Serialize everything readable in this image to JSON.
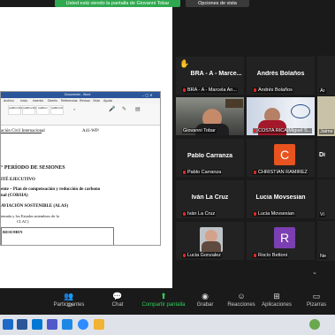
{
  "banner": {
    "sharing_text": "Usted está viendo la pantalla de Giovanni Tobar",
    "view_options": "Opciones de vista"
  },
  "shared_doc": {
    "word_title": "Documento - Word",
    "tabs": [
      "Archivo",
      "Inicio",
      "Insertar",
      "Diseño",
      "Referencias",
      "Revisar",
      "Vista",
      "Ayuda"
    ],
    "styles": [
      "AaBbCcDd",
      "AaBbCcDd",
      "AaBbCc",
      "AaBbCcD"
    ],
    "lines": {
      "org": "ación Civil Internacional",
      "code": "A41-WP/",
      "session": "° PERÍODO DE SESIONES",
      "committee": "ITÉ EJECUTIVO",
      "topic1": "ente – Plan de compensación y reducción de carbono",
      "topic2": "nal (CORSIA)",
      "alas": "AVIACIÓN SOSTENIBLE (ALAS)",
      "states1": "temala y los Estados miembros de la",
      "states2": "CLAC)",
      "resumen": "RESUMEN"
    }
  },
  "participants": [
    {
      "name": "BRA - A - Marce...",
      "caption": "BRA - A - Marcela An...",
      "type": "name",
      "hand": true
    },
    {
      "name": "Andrés Bolaños",
      "caption": "Andrés Bolaños",
      "type": "name"
    },
    {
      "name": "Giovanni Tobar",
      "caption": "Giovanni Tobar",
      "type": "video"
    },
    {
      "name": "COSTA RICA|Miguel S...",
      "caption": "COSTA RICA|Miguel S...",
      "type": "video"
    },
    {
      "name": "Pablo Carranza",
      "caption": "Pablo Carranza",
      "type": "name"
    },
    {
      "name": "CHRISTIAN RAMIREZ",
      "caption": "CHRISTIAN RAMIREZ",
      "type": "avatar",
      "letter": "C",
      "color": "#e8531f"
    },
    {
      "name": "Iván La Cruz",
      "caption": "Iván La Cruz",
      "type": "name"
    },
    {
      "name": "Lucia Movsesian",
      "caption": "Lucia Movsesian",
      "type": "name"
    },
    {
      "name": "Lucia Gonzalez",
      "caption": "Lucia Gonzalez",
      "type": "photo"
    },
    {
      "name": "Rocío Bettoni",
      "caption": "Rocío Bettoni",
      "type": "avatar",
      "letter": "R",
      "color": "#7b3fb3"
    }
  ],
  "partial_tiles": [
    "Ar",
    "Jaime",
    "Di",
    "Vi",
    "Ne"
  ],
  "toolbar": {
    "participants_label": "Participantes",
    "participants_count": "23",
    "chat_label": "Chat",
    "share_label": "Compartir pantalla",
    "record_label": "Grabar",
    "reactions_label": "Reacciones",
    "apps_label": "Aplicaciones",
    "whiteboards_label": "Pizarras"
  }
}
